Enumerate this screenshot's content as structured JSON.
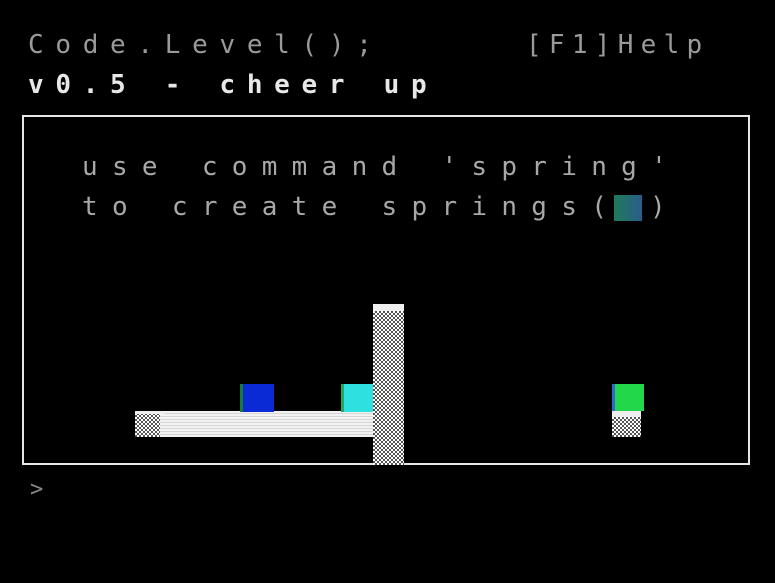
{
  "header": {
    "title": "Code.Level();",
    "help": "[F1]Help",
    "version": "v0.5 - cheer up"
  },
  "instructions": {
    "line1": "use command 'spring'",
    "line2": "to create springs(",
    "line2_close": ")"
  },
  "console": {
    "prompt": ">"
  },
  "colors": {
    "background": "#000000",
    "frame": "#e6e6e6",
    "blue_block": "#0a2ad6",
    "cyan_block": "#2ee0e0",
    "green_block": "#22d84a",
    "spring_swatch": "#1f7a5a"
  }
}
